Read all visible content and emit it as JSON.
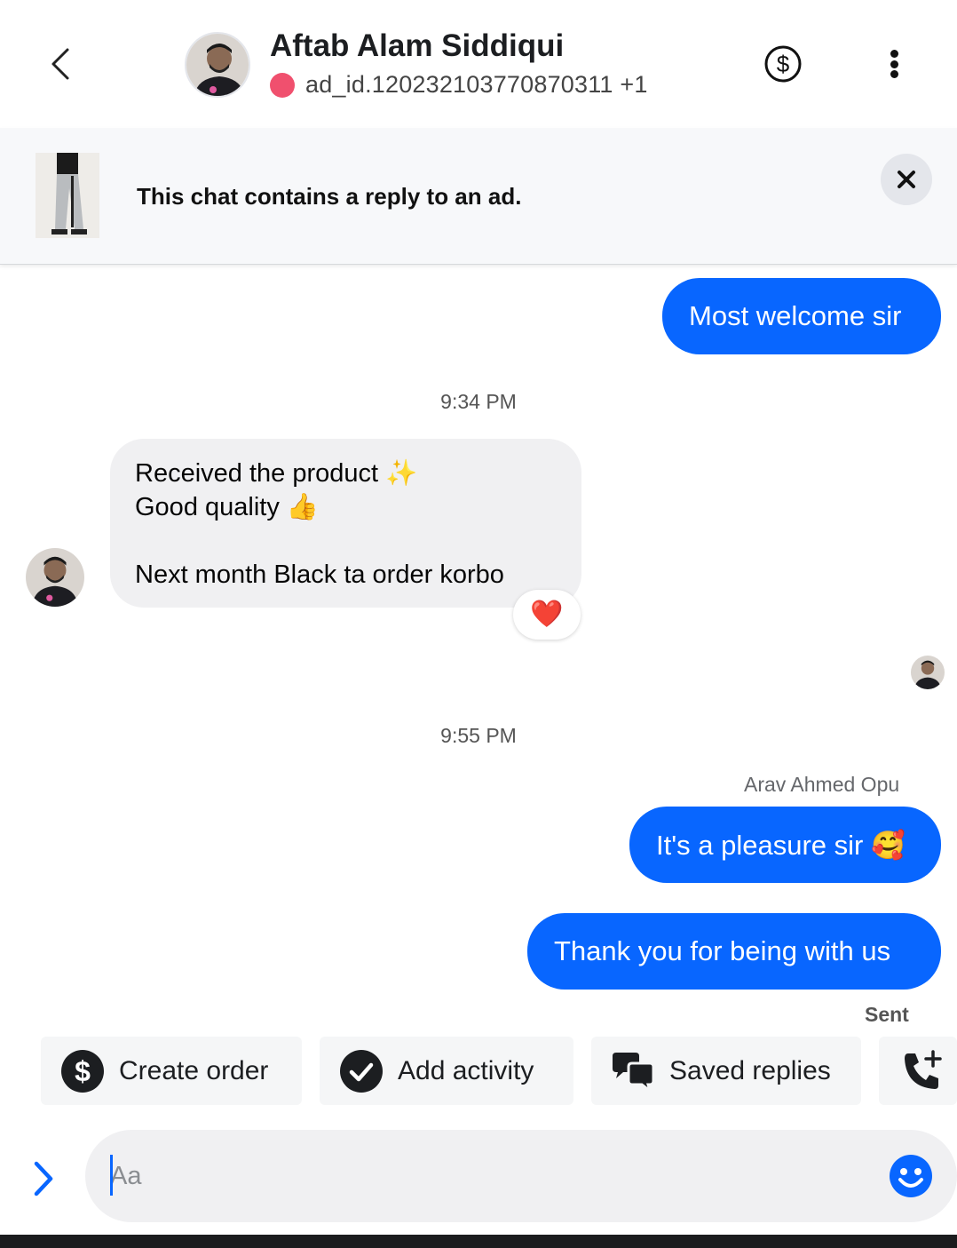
{
  "header": {
    "title": "Aftab Alam Siddiqui",
    "subtitle": "ad_id.120232103770870311 +1",
    "back_icon": "chevron-left-icon",
    "payment_icon": "dollar-circle-icon",
    "more_icon": "more-vertical-icon",
    "status_color": "#f0506e"
  },
  "ad_banner": {
    "text": "This chat contains a reply to an ad."
  },
  "messages": {
    "m1": "Most welcome sir",
    "time1": "9:34 PM",
    "m2_line1": "Received the product ✨",
    "m2_line2": "Good quality 👍",
    "m2_line3": "Next month Black ta order korbo",
    "reaction": "❤️",
    "time2": "9:55 PM",
    "sender": "Arav Ahmed Opu",
    "m3": "It's a pleasure sir 🥰",
    "m4": "Thank you for being with us",
    "status": "Sent"
  },
  "quick_actions": {
    "create_order": "Create order",
    "add_activity": "Add activity",
    "saved_replies": "Saved replies"
  },
  "composer": {
    "placeholder": "Aa"
  },
  "colors": {
    "accent": "#0866ff",
    "incoming_bubble": "#f0f0f2"
  }
}
